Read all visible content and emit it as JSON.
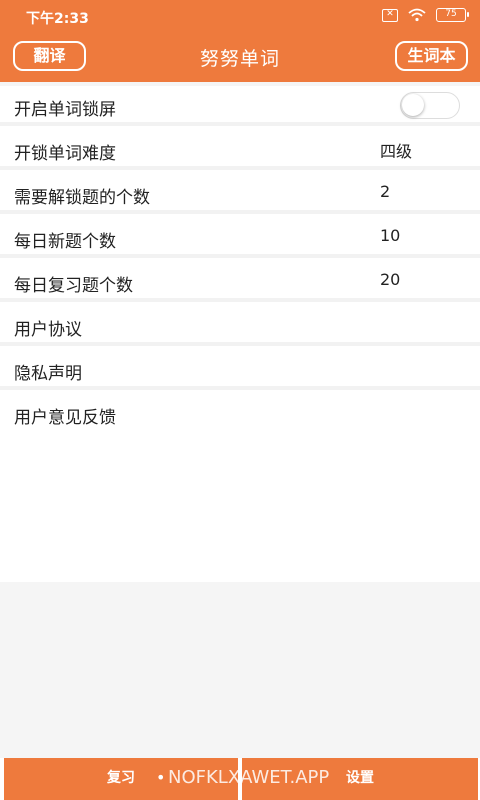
{
  "status": {
    "time": "下午2:33",
    "battery": "75"
  },
  "header": {
    "left_button": "翻译",
    "title": "努努单词",
    "right_button": "生词本"
  },
  "settings": {
    "lock_screen": {
      "label": "开启单词锁屏",
      "enabled": false
    },
    "difficulty": {
      "label": "开锁单词难度",
      "value": "四级"
    },
    "unlock_count": {
      "label": "需要解锁题的个数",
      "value": "2"
    },
    "daily_new": {
      "label": "每日新题个数",
      "value": "10"
    },
    "daily_review": {
      "label": "每日复习题个数",
      "value": "20"
    },
    "user_agreement": {
      "label": "用户协议"
    },
    "privacy": {
      "label": "隐私声明"
    },
    "feedback": {
      "label": "用户意见反馈"
    }
  },
  "tabs": {
    "review": "复习",
    "settings": "设置"
  },
  "watermark": "NOFKLXAWET.APP",
  "colors": {
    "accent": "#ee7a3d"
  }
}
